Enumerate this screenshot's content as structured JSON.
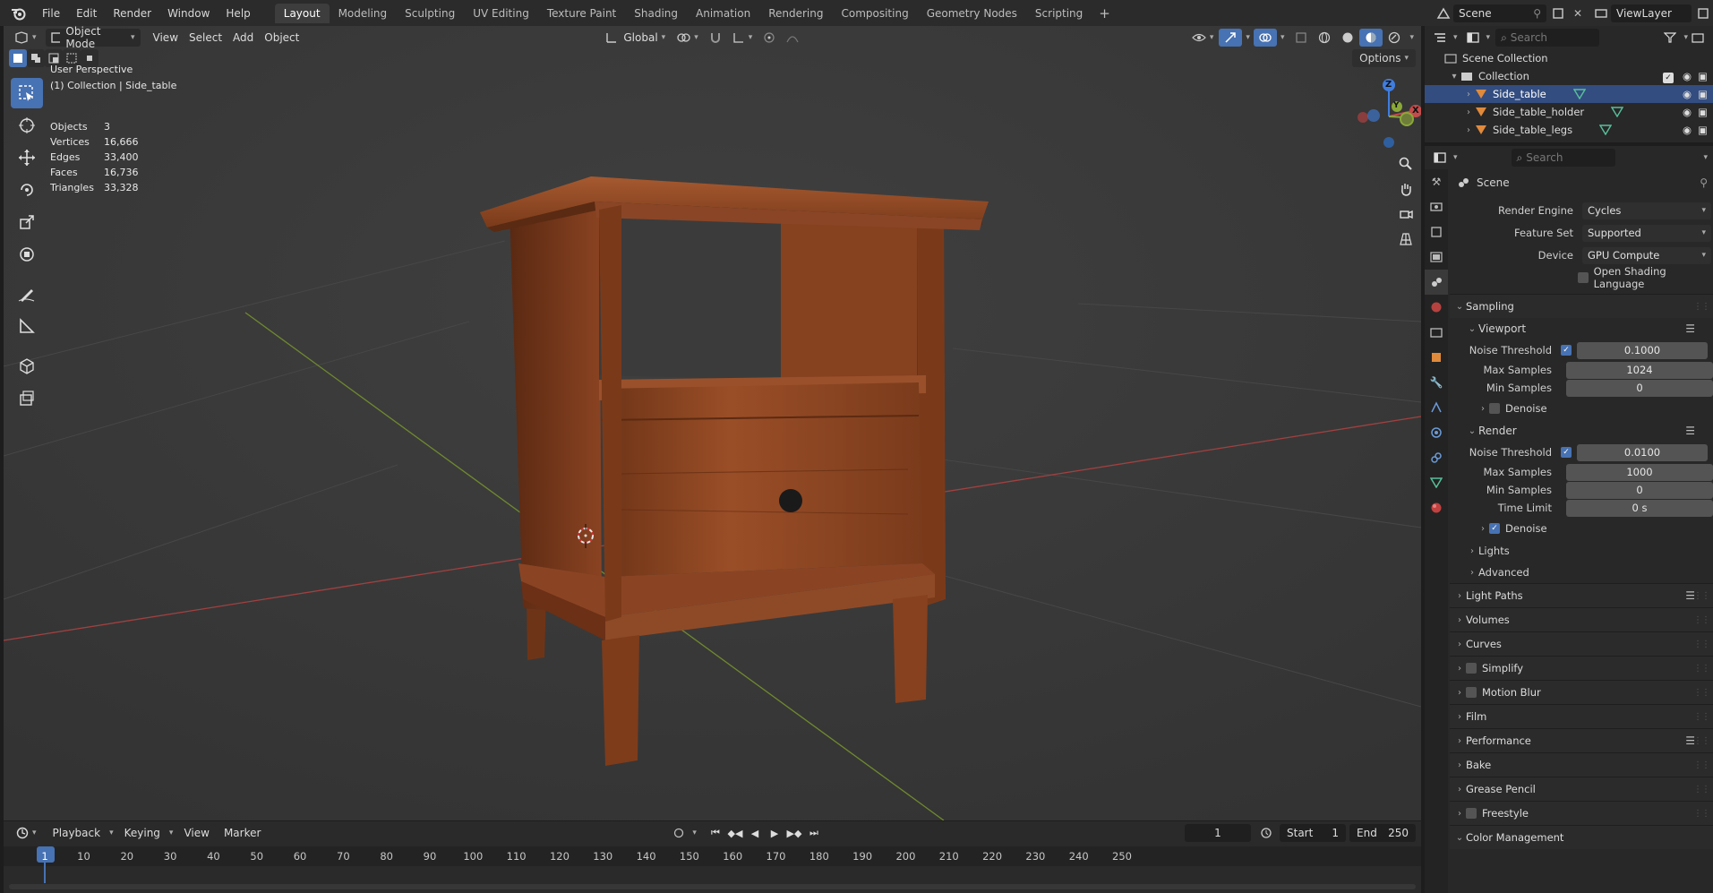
{
  "topbar": {
    "menus": [
      "File",
      "Edit",
      "Render",
      "Window",
      "Help"
    ],
    "workspaces": [
      "Layout",
      "Modeling",
      "Sculpting",
      "UV Editing",
      "Texture Paint",
      "Shading",
      "Animation",
      "Rendering",
      "Compositing",
      "Geometry Nodes",
      "Scripting"
    ],
    "active_workspace": "Layout",
    "scene_name": "Scene",
    "view_layer": "ViewLayer"
  },
  "viewport": {
    "mode": "Object Mode",
    "menus": [
      "View",
      "Select",
      "Add",
      "Object"
    ],
    "orientation": "Global",
    "options_label": "Options",
    "overlay": {
      "perspective": "User Perspective",
      "collection_line": "(1) Collection | Side_table"
    },
    "stats": [
      {
        "key": "Objects",
        "value": "3"
      },
      {
        "key": "Vertices",
        "value": "16,666"
      },
      {
        "key": "Edges",
        "value": "33,400"
      },
      {
        "key": "Faces",
        "value": "16,736"
      },
      {
        "key": "Triangles",
        "value": "33,328"
      }
    ],
    "gizmo_axes": {
      "x": "X",
      "y": "Y",
      "z": "Z"
    }
  },
  "timeline": {
    "menus": [
      "Playback",
      "Keying",
      "View",
      "Marker"
    ],
    "current_frame": "1",
    "start_label": "Start",
    "start": "1",
    "end_label": "End",
    "end": "250",
    "ticks": [
      "1",
      "10",
      "20",
      "30",
      "40",
      "50",
      "60",
      "70",
      "80",
      "90",
      "100",
      "110",
      "120",
      "130",
      "140",
      "150",
      "160",
      "170",
      "180",
      "190",
      "200",
      "210",
      "220",
      "230",
      "240",
      "250"
    ]
  },
  "outliner": {
    "search_placeholder": "Search",
    "root": "Scene Collection",
    "collection": "Collection",
    "items": [
      "Side_table",
      "Side_table_holder",
      "Side_table_legs"
    ]
  },
  "properties": {
    "search_placeholder": "Search",
    "context": "Scene",
    "render_engine_label": "Render Engine",
    "render_engine": "Cycles",
    "feature_set_label": "Feature Set",
    "feature_set": "Supported",
    "device_label": "Device",
    "device": "GPU Compute",
    "osl_label": "Open Shading Language",
    "sampling": "Sampling",
    "viewport": {
      "title": "Viewport",
      "noise_threshold_label": "Noise Threshold",
      "noise_threshold": "0.1000",
      "max_samples_label": "Max Samples",
      "max_samples": "1024",
      "min_samples_label": "Min Samples",
      "min_samples": "0",
      "denoise_label": "Denoise"
    },
    "render": {
      "title": "Render",
      "noise_threshold_label": "Noise Threshold",
      "noise_threshold": "0.0100",
      "max_samples_label": "Max Samples",
      "max_samples": "1000",
      "min_samples_label": "Min Samples",
      "min_samples": "0",
      "time_limit_label": "Time Limit",
      "time_limit": "0 s",
      "denoise_label": "Denoise"
    },
    "lights": "Lights",
    "advanced": "Advanced",
    "panels": [
      "Light Paths",
      "Volumes",
      "Curves",
      "Simplify",
      "Motion Blur",
      "Film",
      "Performance",
      "Bake",
      "Grease Pencil",
      "Freestyle",
      "Color Management"
    ]
  },
  "colors": {
    "accent": "#4772b3",
    "wood": "#8a4424",
    "axis_x": "#c44b4b",
    "axis_y": "#8aa838",
    "axis_z": "#3f7ee0"
  }
}
